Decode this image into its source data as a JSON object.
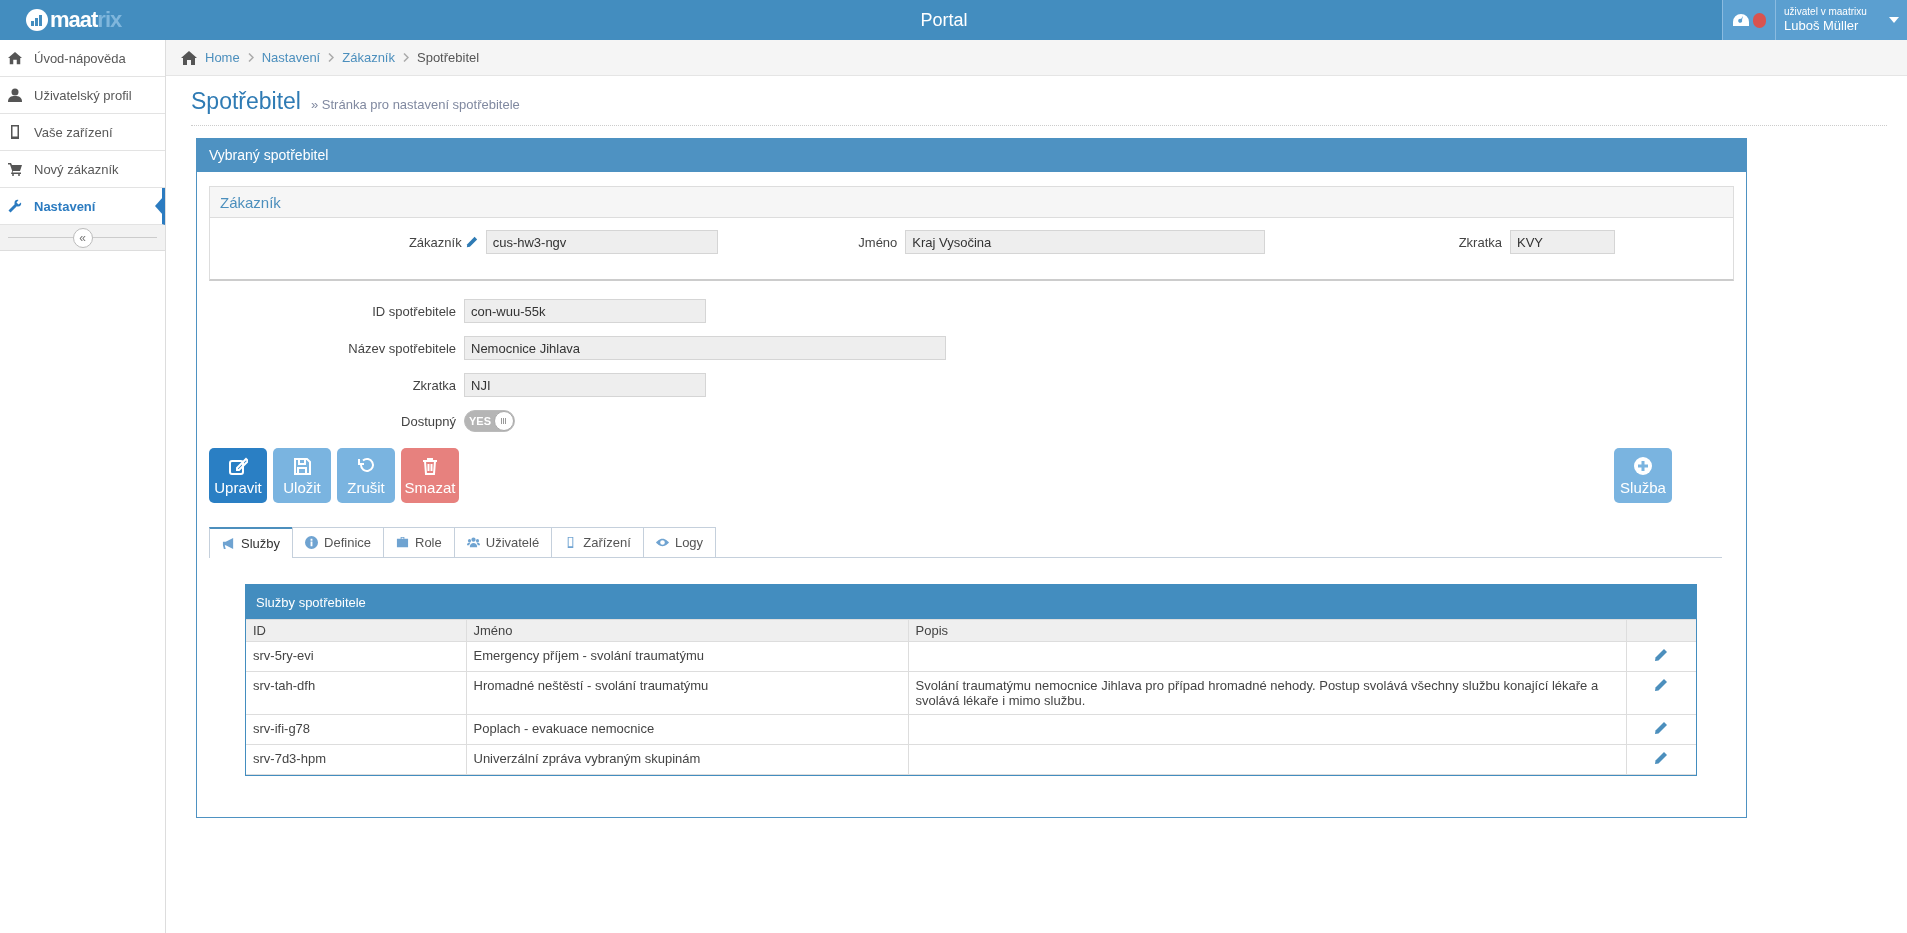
{
  "topbar": {
    "logo": {
      "bold": "maat",
      "light": "rix"
    },
    "title": "Portal",
    "notification": {
      "color": "#d9534f"
    },
    "user": {
      "caption": "uživatel v maatrixu",
      "name": "Luboš Müller"
    }
  },
  "sidebar": {
    "items": [
      {
        "label": "Úvod-nápověda",
        "selected": false
      },
      {
        "label": "Uživatelský profil",
        "selected": false
      },
      {
        "label": "Vaše zařízení",
        "selected": false
      },
      {
        "label": "Nový zákazník",
        "selected": false
      },
      {
        "label": "Nastavení",
        "selected": true
      }
    ],
    "collapse": "«"
  },
  "breadcrumb": [
    "Home",
    "Nastavení",
    "Zákazník",
    "Spotřebitel"
  ],
  "page": {
    "title": "Spotřebitel",
    "subtitle": "» Stránka pro nastavení spotřebitele"
  },
  "panel": {
    "title": "Vybraný spotřebitel",
    "customer": {
      "title": "Zákazník",
      "fields": [
        {
          "label": "Zákazník",
          "value": "cus-hw3-ngv",
          "editable_icon": true
        },
        {
          "label": "Jméno",
          "value": "Kraj Vysočina",
          "editable_icon": false
        },
        {
          "label": "Zkratka",
          "value": "KVY",
          "editable_icon": false
        }
      ]
    },
    "fields": [
      {
        "kind": "text",
        "label": "ID spotřebitele",
        "value": "con-wuu-55k"
      },
      {
        "kind": "text",
        "label": "Název spotřebitele",
        "value": "Nemocnice Jihlava"
      },
      {
        "kind": "text",
        "label": "Zkratka",
        "value": "NJI"
      },
      {
        "kind": "switch",
        "label": "Dostupný",
        "value": "YES",
        "on": true,
        "disabled": true
      }
    ],
    "buttons": [
      {
        "label": "Upravit",
        "kind": "primary",
        "disabled": false
      },
      {
        "label": "Uložit",
        "kind": "primary",
        "disabled": true
      },
      {
        "label": "Zrušit",
        "kind": "primary",
        "disabled": true
      },
      {
        "label": "Smazat",
        "kind": "danger",
        "disabled": true
      }
    ],
    "add_button": {
      "label": "Služba",
      "disabled": true
    },
    "tabs": [
      {
        "label": "Služby",
        "selected": true
      },
      {
        "label": "Definice",
        "selected": false
      },
      {
        "label": "Role",
        "selected": false
      },
      {
        "label": "Uživatelé",
        "selected": false
      },
      {
        "label": "Zařízení",
        "selected": false
      },
      {
        "label": "Logy",
        "selected": false
      }
    ],
    "table": {
      "title": "Služby spotřebitele",
      "columns": [
        "ID",
        "Jméno",
        "Popis"
      ],
      "rows": [
        [
          "srv-5ry-evi",
          "Emergency příjem - svolání traumatýmu",
          ""
        ],
        [
          "srv-tah-dfh",
          "Hromadné neštěstí - svolání traumatýmu",
          "Svolání traumatýmu nemocnice Jihlava pro případ hromadné nehody. Postup svolává všechny službu konající lékaře a svolává lékaře i mimo službu."
        ],
        [
          "srv-ifi-g78",
          "Poplach - evakuace nemocnice",
          ""
        ],
        [
          "srv-7d3-hpm",
          "Univerzální zpráva vybraným skupinám",
          ""
        ]
      ]
    }
  }
}
